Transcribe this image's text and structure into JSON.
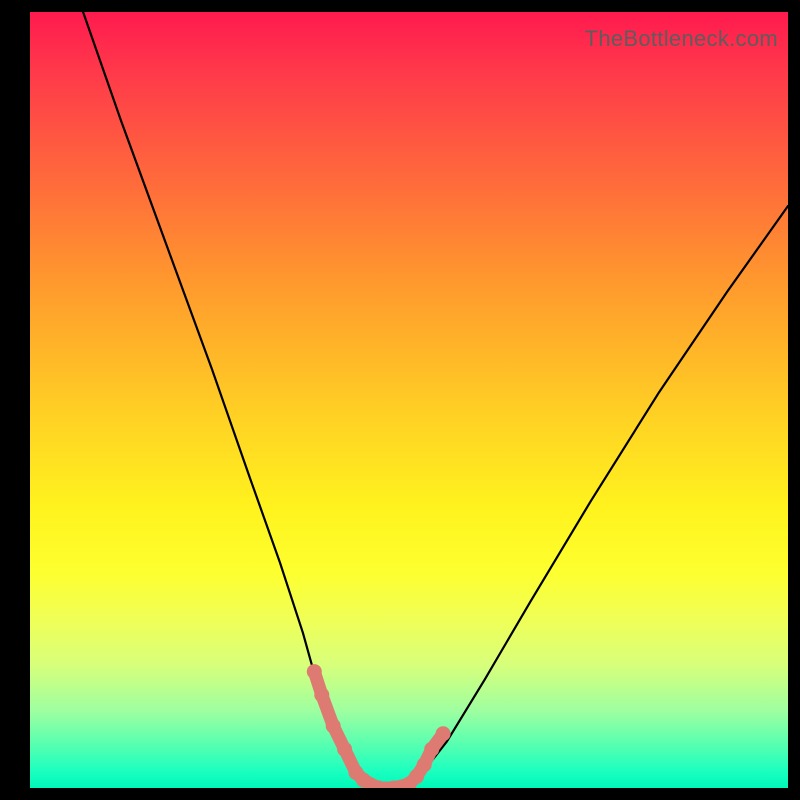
{
  "watermark": "TheBottleneck.com",
  "chart_data": {
    "type": "line",
    "title": "",
    "xlabel": "",
    "ylabel": "",
    "xlim": [
      0,
      100
    ],
    "ylim": [
      0,
      100
    ],
    "grid": false,
    "legend": false,
    "series": [
      {
        "name": "curve",
        "color": "#000000",
        "x": [
          7,
          12,
          18,
          24,
          29,
          33,
          36,
          38,
          40,
          42,
          44,
          47,
          49,
          51,
          55,
          60,
          66,
          74,
          83,
          92,
          100
        ],
        "y": [
          100,
          86,
          70,
          54,
          40,
          29,
          20,
          13,
          8,
          4,
          1,
          0,
          0,
          1,
          6,
          14,
          24,
          37,
          51,
          64,
          75
        ]
      },
      {
        "name": "salmon-highlight",
        "color": "#e07870",
        "x": [
          37.5,
          38.5,
          40,
          41.5,
          43,
          44,
          46,
          48,
          50,
          51,
          52,
          53,
          54.5
        ],
        "y": [
          15,
          12,
          8,
          5,
          2,
          1,
          0,
          0,
          0.5,
          1.5,
          3,
          5,
          7
        ]
      }
    ],
    "background_gradient": {
      "top": "#ff1a4f",
      "mid": "#ffe321",
      "bottom": "#00f7b8"
    }
  }
}
